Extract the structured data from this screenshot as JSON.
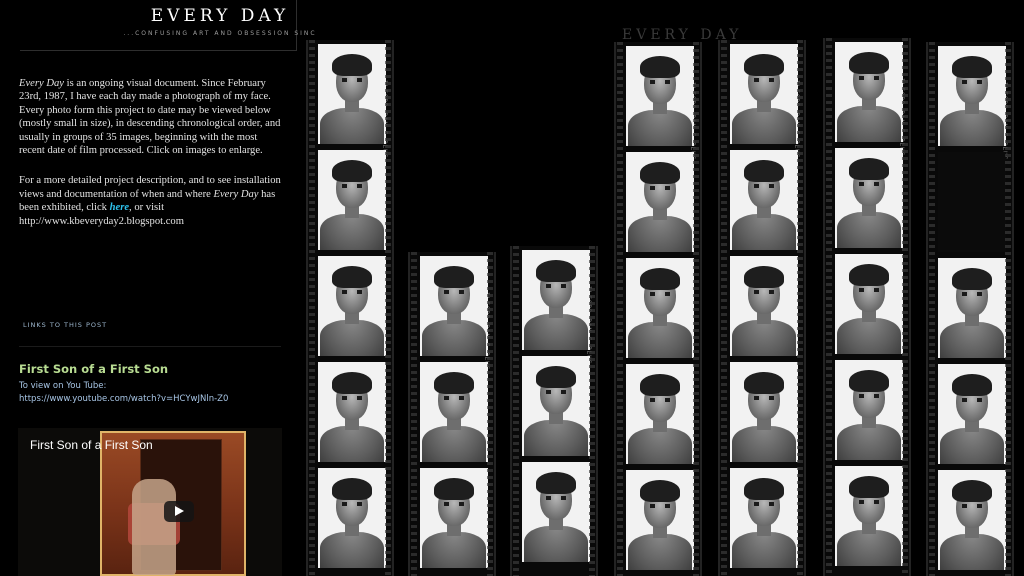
{
  "header": {
    "site_title": "EVERY DAY",
    "tagline": "...CONFUSING ART AND OBSESSION SINC"
  },
  "intro": {
    "p1_em": "Every Day",
    "p1_rest": " is an ongoing visual document. Since February 23rd, 1987, I have each day made a photograph of my face. Every photo form this project to date may be viewed below (mostly small in size), in descending chronological order, and usually in groups of 35 images, beginning with the most recent date of film processed. Click on images to enlarge.",
    "p2_a": "For a more detailed project description, and to see installation views and documentation of when and where ",
    "p2_em": "Every Day",
    "p2_b": " has been exhibited, click ",
    "p2_link": "here",
    "p2_c": ", or visit",
    "p2_url": "http://www.kbeveryday2.blogspot.com"
  },
  "links_label": "LINKS TO THIS POST",
  "post": {
    "title": "First Son of a First Son",
    "line1": "To view on You Tube:",
    "line2": "https://www.youtube.com/watch?v=HCYwJNln-Z0"
  },
  "video": {
    "title": "First Son of a First Son",
    "play_icon": "play-icon"
  },
  "sheets": {
    "faded_header": "EVERY DAY",
    "film_stock": "ILFORD PAN F PLUS"
  }
}
